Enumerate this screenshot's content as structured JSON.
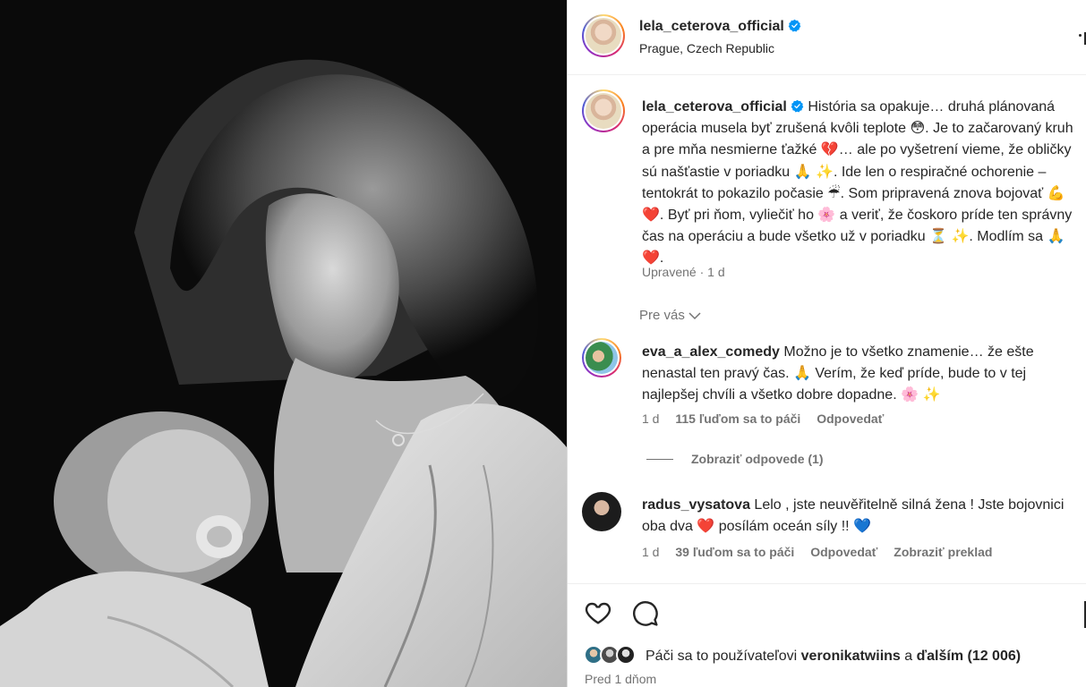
{
  "post": {
    "username": "lela_ceterova_official",
    "location": "Prague, Czech Republic"
  },
  "caption": {
    "username": "lela_ceterova_official",
    "text": "História sa opakuje… druhá plánovaná operácia musela byť zrušená kvôli teplote 😳. Je to začarovaný kruh a pre mňa nesmierne ťažké 💔… ale po vyšetrení vieme, že obličky sú našťastie v poriadku 🙏 ✨. Ide len o respiračné ochorenie – tentokrát to pokazilo počasie ☔. Som pripravená znova bojovať 💪 ❤️. Byť pri ňom, vyliečiť ho 🌸 a veriť, že čoskoro príde ten správny čas na operáciu a bude všetko už v poriadku ⏳ ✨. Modlím sa 🙏 ❤️.",
    "meta": "Upravené · 1 d"
  },
  "filter": {
    "label": "Pre vás"
  },
  "comments": [
    {
      "username": "eva_a_alex_comedy",
      "text": "Možno je to všetko znamenie… že ešte nenastal ten pravý čas. 🙏 Verím, že keď príde, bude to v tej najlepšej chvíli a všetko dobre dopadne. 🌸 ✨",
      "time": "1 d",
      "likes": "115 ľuďom sa to páči",
      "reply": "Odpovedať",
      "view_replies": "Zobraziť odpovede (1)"
    },
    {
      "username": "radus_vysatova",
      "text": "Lelo , jste neuvěřitelně silná žena ! Jste bojovnici oba dva ❤️ posílám oceán síly !! 💙",
      "time": "1 d",
      "likes": "39 ľuďom sa to páči",
      "reply": "Odpovedať",
      "translate": "Zobraziť preklad"
    }
  ],
  "actions": {
    "icons": [
      "heart-icon",
      "comment-icon"
    ],
    "likes_prefix": "Páči sa to používateľovi",
    "likes_user": "veronikatwiins",
    "likes_and": "a",
    "likes_others": "ďalším (12 006)",
    "posted": "Pred 1 dňom"
  },
  "colors": {
    "verified": "#0095f6",
    "secondary_text": "#737373",
    "primary_text": "#262626"
  }
}
